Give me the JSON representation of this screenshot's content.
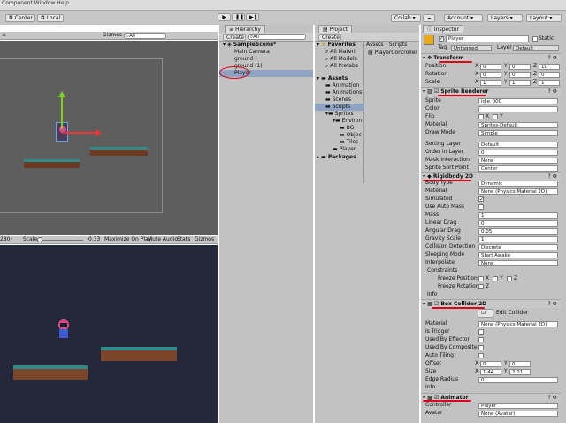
{
  "menubar": {
    "items": "Component  Window  Help"
  },
  "toolbar": {
    "center": "Center",
    "local": "Local",
    "collab": "Collab ▾",
    "account": "Account",
    "layers": "Layers",
    "layout": "Layout"
  },
  "scene": {
    "gizmos": "Gizmos ▾",
    "search": "All"
  },
  "game": {
    "res": "280)",
    "scale_label": "Scale",
    "scale_value": "0.33",
    "maximize": "Maximize On Play",
    "mute": "Mute Audio",
    "stats": "Stats",
    "gizmos": "Gizmos"
  },
  "hierarchy": {
    "tab": "Hierarchy",
    "create": "Create",
    "search": "All",
    "scene": "SampleScene*",
    "items": [
      "Main Camera",
      "ground",
      "ground (1)",
      "Player"
    ]
  },
  "project": {
    "tab": "Project",
    "create": "Create",
    "favorites": "Favorites",
    "fav_items": [
      "All Materi",
      "All Models",
      "All Prefabs"
    ],
    "assets": "Assets",
    "asset_items": [
      "Animation",
      "Animations",
      "Scenes",
      "Scripts",
      "Sprites"
    ],
    "sprite_items": [
      "Environ",
      "BG",
      "Objec",
      "Tiles",
      "Player"
    ],
    "packages": "Packages",
    "breadcrumb": "Assets › Scripts",
    "file": "PlayerController"
  },
  "inspector": {
    "tab": "Inspector",
    "name": "Player",
    "static": "Static",
    "tag_label": "Tag",
    "tag": "Untagged",
    "layer_label": "Layer",
    "layer": "Default",
    "transform": {
      "title": "Transform",
      "rows": [
        {
          "l": "Position",
          "x": "0",
          "y": "0",
          "z": "10"
        },
        {
          "l": "Rotation",
          "x": "0",
          "y": "0",
          "z": "0"
        },
        {
          "l": "Scale",
          "x": "1",
          "y": "1",
          "z": "1"
        }
      ]
    },
    "sprite_renderer": {
      "title": "Sprite Renderer",
      "sprite": "idle_000",
      "color": "",
      "material": "Sprites-Default",
      "draw_mode": "Simple",
      "sorting_layer": "Default",
      "order": "0",
      "mask": "None",
      "sort_point": "Center",
      "labels": [
        "Sprite",
        "Color",
        "Flip",
        "Material",
        "Draw Mode",
        "Sorting Layer",
        "Order in Layer",
        "Mask Interaction",
        "Sprite Sort Point"
      ]
    },
    "rigidbody": {
      "title": "Rigidbody 2D",
      "body_type": "Dynamic",
      "material": "None (Physics Material 2D)",
      "mass": "1",
      "linear_drag": "0",
      "angular_drag": "0.05",
      "gravity": "1",
      "collision": "Discrete",
      "sleeping": "Start Awake",
      "interpolate": "None",
      "labels": [
        "Body Type",
        "Material",
        "Simulated",
        "Use Auto Mass",
        "Mass",
        "Linear Drag",
        "Angular Drag",
        "Gravity Scale",
        "Collision Detection",
        "Sleeping Mode",
        "Interpolate",
        "Constraints",
        "Freeze Position",
        "Freeze Rotation",
        "Info"
      ]
    },
    "box_collider": {
      "title": "Box Collider 2D",
      "edit": "Edit Collider",
      "material": "None (Physics Material 2D)",
      "offset_x": "0",
      "offset_y": "0",
      "size_x": "1.44",
      "size_y": "2.21",
      "edge_radius": "0",
      "labels": [
        "Material",
        "Is Trigger",
        "Used By Effector",
        "Used By Composite",
        "Auto Tiling",
        "Offset",
        "Size",
        "Edge Radius",
        "Info"
      ]
    },
    "animator": {
      "title": "Animator",
      "controller": "Player",
      "avatar": "None (Avatar)",
      "labels": [
        "Controller",
        "Avatar"
      ]
    }
  },
  "colors": {
    "annotation": "#e0001a",
    "game_bg": "#24283a",
    "scene_bg": "#5e5e5e"
  }
}
